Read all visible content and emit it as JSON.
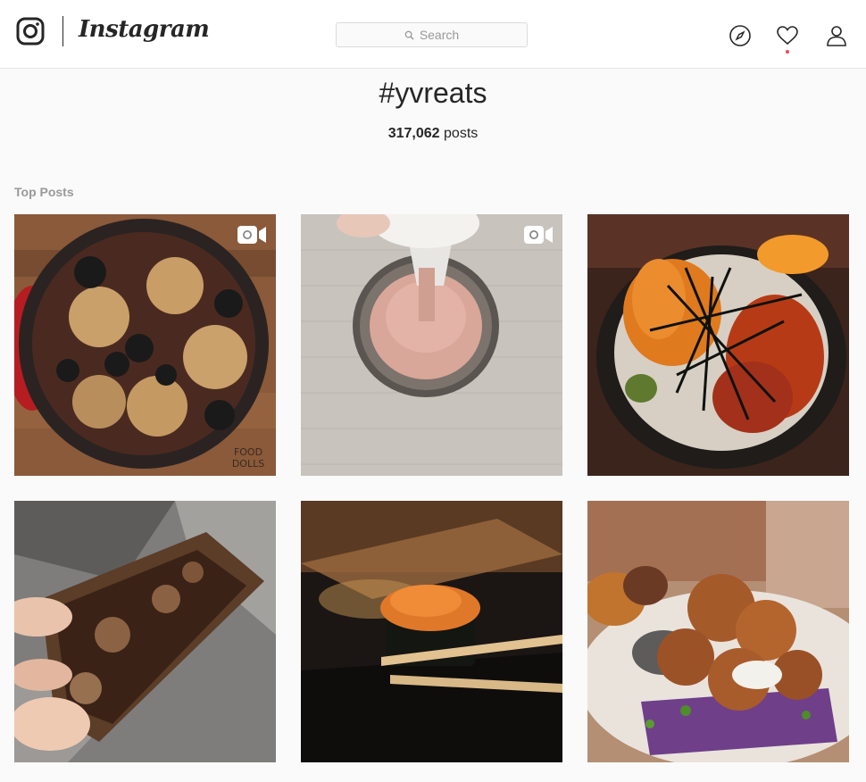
{
  "brand": {
    "wordmark": "Instagram"
  },
  "search": {
    "placeholder": "Search"
  },
  "nav": {
    "icons": [
      "explore-icon",
      "heart-icon",
      "profile-icon"
    ],
    "notification_color": "#ed4956"
  },
  "hashtag": {
    "title": "#yvreats",
    "count": "317,062",
    "count_suffix": "posts"
  },
  "section": {
    "label": "Top Posts"
  },
  "posts": [
    {
      "subject": "skillet brownie with cookies and oreos",
      "video": true,
      "watermark": "FOOD DOLLS"
    },
    {
      "subject": "piping macaron batter onto mat",
      "video": true
    },
    {
      "subject": "eel and uni rice bowl",
      "video": false
    },
    {
      "subject": "chocolate cookie bar",
      "video": false
    },
    {
      "subject": "uni sushi held with chopsticks",
      "video": false
    },
    {
      "subject": "fried chicken on ube waffle",
      "video": false
    }
  ],
  "colors": {
    "header_bg": "#ffffff",
    "page_bg": "#fafafa",
    "text": "#262626",
    "muted": "#999999",
    "border": "#dbdbdb"
  }
}
